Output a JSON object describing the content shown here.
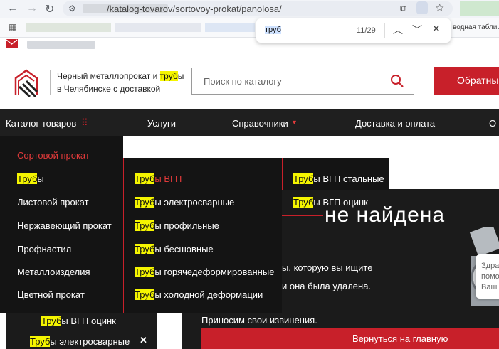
{
  "browser": {
    "url_visible": "/katalog-tovarov/sortovoy-prokat/panolosa/",
    "bookmark_right": "водная таблица"
  },
  "find": {
    "query": "труб",
    "count": "11/29"
  },
  "header": {
    "tagline_1_pre": "Черный металлопрокат и ",
    "tagline_1_hl": "труб",
    "tagline_1_post": "ы",
    "tagline_2": "в Челябинске с доставкой",
    "search_placeholder": "Поиск по каталогу",
    "cta": "Обратный"
  },
  "nav": {
    "catalog": "Каталог товаров",
    "services": "Услуги",
    "reference": "Справочники",
    "delivery": "Доставка и оплата",
    "more": "О"
  },
  "menu": {
    "col1": [
      {
        "hl": "",
        "rest": "Сортовой прокат",
        "active": true
      },
      {
        "hl": "Труб",
        "rest": "ы",
        "active": false
      },
      {
        "hl": "",
        "rest": "Листовой прокат",
        "active": false
      },
      {
        "hl": "",
        "rest": "Нержавеющий прокат",
        "active": false
      },
      {
        "hl": "",
        "rest": "Профнастил",
        "active": false
      },
      {
        "hl": "",
        "rest": "Металлоизделия",
        "active": false
      },
      {
        "hl": "",
        "rest": "Цветной прокат",
        "active": false
      }
    ],
    "col2": [
      {
        "hl": "Труб",
        "rest": "ы ВГП",
        "active": true
      },
      {
        "hl": "Труб",
        "rest": "ы электросварные",
        "active": false
      },
      {
        "hl": "Труб",
        "rest": "ы профильные",
        "active": false
      },
      {
        "hl": "Труб",
        "rest": "ы бесшовные",
        "active": false
      },
      {
        "hl": "Труб",
        "rest": "ы горячедеформированные",
        "active": false
      },
      {
        "hl": "Труб",
        "rest": "ы холодной деформации",
        "active": false
      }
    ],
    "col3": [
      {
        "hl": "Труб",
        "rest": "ы ВГП стальные"
      },
      {
        "hl": "Труб",
        "rest": "ы ВГП оцинк"
      }
    ]
  },
  "content": {
    "title_visible": "не найдена",
    "line1": "ы, которую вы ищите",
    "line2": "и она была удалена.",
    "line3": "Приносим свои извинения.",
    "back_button": "Вернуться на главную"
  },
  "chat": {
    "l1": "Здра",
    "l2": "помо",
    "l3": "Ваш"
  },
  "popup": {
    "i1_hl": "Труб",
    "i1_rest": "ы ВГП оцинк",
    "i2_hl": "Труб",
    "i2_rest": "ы электросварные",
    "close": "✕"
  },
  "colors": {
    "accent": "#c8202a",
    "dark": "#1b1b1b",
    "highlight": "#f5f500"
  }
}
